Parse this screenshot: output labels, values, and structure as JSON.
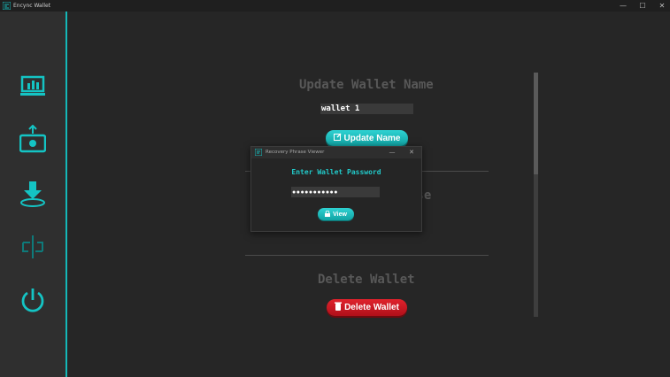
{
  "window": {
    "title": "Encync Wallet",
    "minimize": "—",
    "maximize": "☐",
    "close": "✕"
  },
  "sidebar": {
    "items": [
      {
        "name": "dashboard",
        "icon": "chart-icon"
      },
      {
        "name": "send",
        "icon": "upload-icon"
      },
      {
        "name": "receive",
        "icon": "download-icon"
      },
      {
        "name": "exchange",
        "icon": "exchange-icon"
      },
      {
        "name": "power",
        "icon": "power-icon"
      }
    ]
  },
  "main": {
    "update": {
      "title": "Update Wallet Name",
      "input_value": "wallet 1",
      "button_label": "Update Name"
    },
    "recovery": {
      "title_visible": "ase"
    },
    "delete": {
      "title": "Delete Wallet",
      "button_label": "Delete Wallet"
    }
  },
  "dialog": {
    "title": "Recovery Phrase Viewer",
    "heading": "Enter Wallet Password",
    "password_value": "●●●●●●●●●●●",
    "view_label": "View"
  },
  "colors": {
    "accent": "#14b8b8",
    "danger": "#c8151f",
    "sidebar_bg": "#2f2f2f",
    "main_bg": "#262626"
  }
}
